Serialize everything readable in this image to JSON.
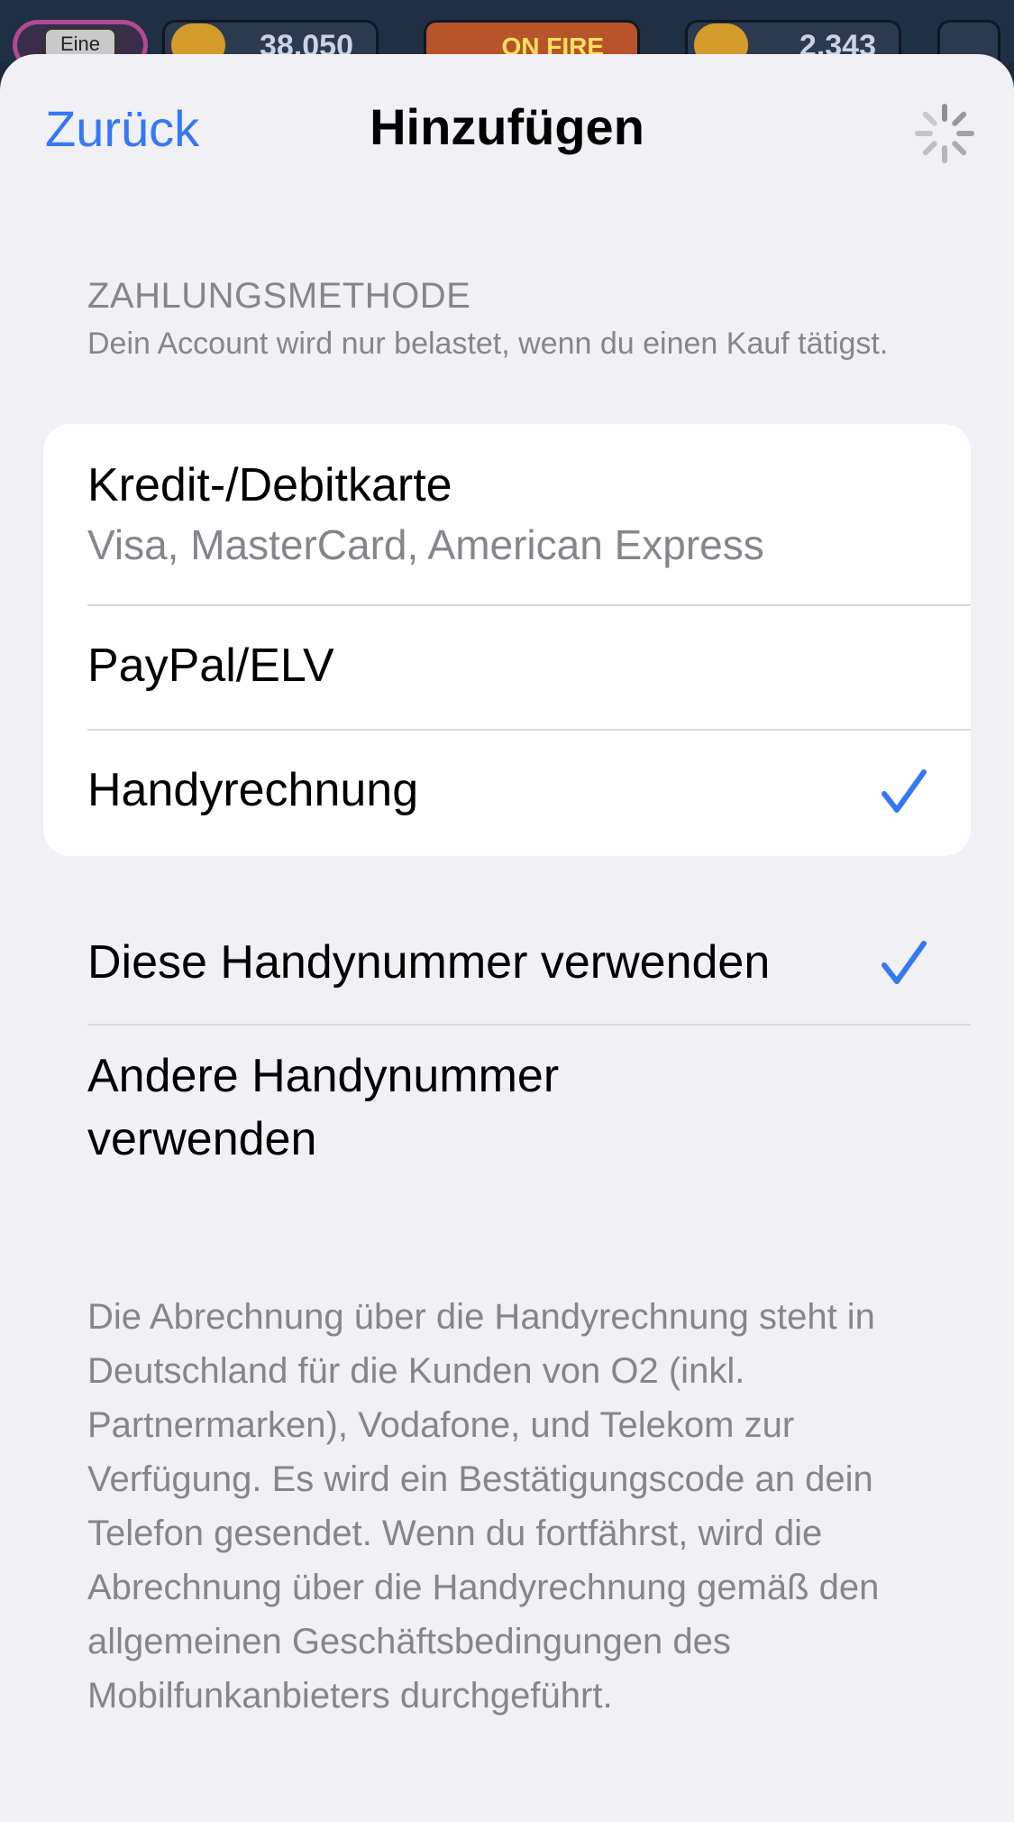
{
  "background_hud": {
    "level_label": "Eine",
    "trophies": "38.050",
    "streak": "ON FIRE",
    "coins": "2.343"
  },
  "nav": {
    "back_label": "Zurück",
    "title": "Hinzufügen"
  },
  "section": {
    "header": "ZAHLUNGSMETHODE",
    "subtitle": "Dein Account wird nur belastet, wenn du einen Kauf tätigst."
  },
  "payment_methods": [
    {
      "title": "Kredit-/Debitkarte",
      "subtitle": "Visa, MasterCard, American Express",
      "selected": false
    },
    {
      "title": "PayPal/ELV",
      "selected": false
    },
    {
      "title": "Handyrechnung",
      "selected": true
    }
  ],
  "phone_options": [
    {
      "title": "Diese Handynummer verwenden",
      "selected": true
    },
    {
      "title": "Andere Handynummer verwenden",
      "selected": false
    }
  ],
  "footer": {
    "text": "Die Abrechnung über die Handyrechnung steht in Deutschland für die Kunden von O2 (inkl. Partnermarken), Vodafone, und Telekom zur Verfügung. Es wird ein Bestätigungscode an dein Telefon gesendet. Wenn du fortfährst, wird die Abrechnung über die Handyrechnung gemäß den allgemeinen Geschäftsbedingungen des Mobilfunkanbieters durchgeführt."
  },
  "colors": {
    "accent": "#3478f6",
    "secondary_text": "#86858b",
    "sheet_background": "#f1f0f5"
  }
}
